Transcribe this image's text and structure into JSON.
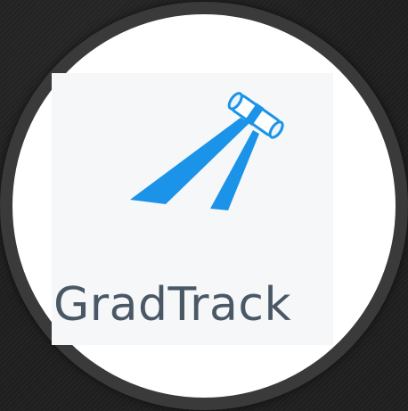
{
  "brand": {
    "name": "GradTrack",
    "logo_icon": "graduation-scroll-beam-icon",
    "colors": {
      "beam": "#1a93e8",
      "scroll": "#ffffff",
      "wordmark": "#4a5866",
      "ring": "#3a3a3b",
      "background": "#1f1f20"
    }
  }
}
